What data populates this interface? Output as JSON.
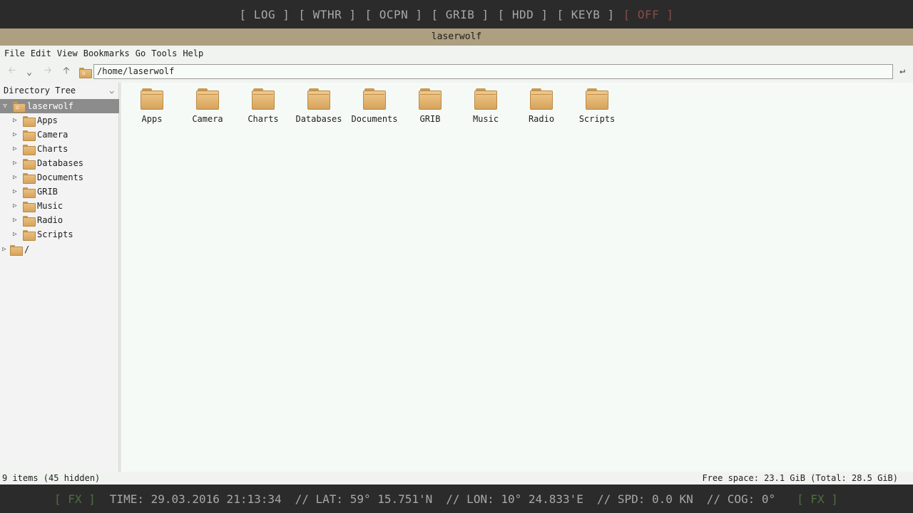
{
  "top_bar": {
    "buttons": [
      "[ LOG ]",
      "[ WTHR ]",
      "[ OCPN ]",
      "[ GRIB ]",
      "[ HDD ]",
      "[ KEYB ]"
    ],
    "off_button": "[ OFF ]"
  },
  "window": {
    "title": "laserwolf"
  },
  "menu": [
    "File",
    "Edit",
    "View",
    "Bookmarks",
    "Go",
    "Tools",
    "Help"
  ],
  "toolbar": {
    "icons": [
      "back-arrow-icon",
      "history-dropdown-icon",
      "forward-arrow-icon",
      "up-arrow-icon",
      "home-icon",
      "go-icon"
    ],
    "location": "/home/laserwolf"
  },
  "sidebar": {
    "header": "Directory Tree",
    "root": "laserwolf",
    "children": [
      "Apps",
      "Camera",
      "Charts",
      "Databases",
      "Documents",
      "GRIB",
      "Music",
      "Radio",
      "Scripts"
    ],
    "filesystem_root": "/"
  },
  "main": {
    "folders": [
      "Apps",
      "Camera",
      "Charts",
      "Databases",
      "Documents",
      "GRIB",
      "Music",
      "Radio",
      "Scripts"
    ]
  },
  "status": {
    "left": "9 items (45 hidden)",
    "right": "Free space: 23.1 GiB (Total: 28.5 GiB)"
  },
  "bottom_bar": {
    "fx_left": "[ FX ]",
    "time": "TIME: 29.03.2016 21:13:34",
    "lat": "// LAT: 59° 15.751'N",
    "lon": "// LON: 10° 24.833'E",
    "spd": "// SPD: 0.0 KN",
    "cog": "// COG: 0°",
    "fx_right": "[ FX ]"
  },
  "colors": {
    "title_bar": "#ad9f7f",
    "off_button": "#8a4c46",
    "fx_button": "#4f6f3f",
    "folder": "#e2b16c"
  }
}
